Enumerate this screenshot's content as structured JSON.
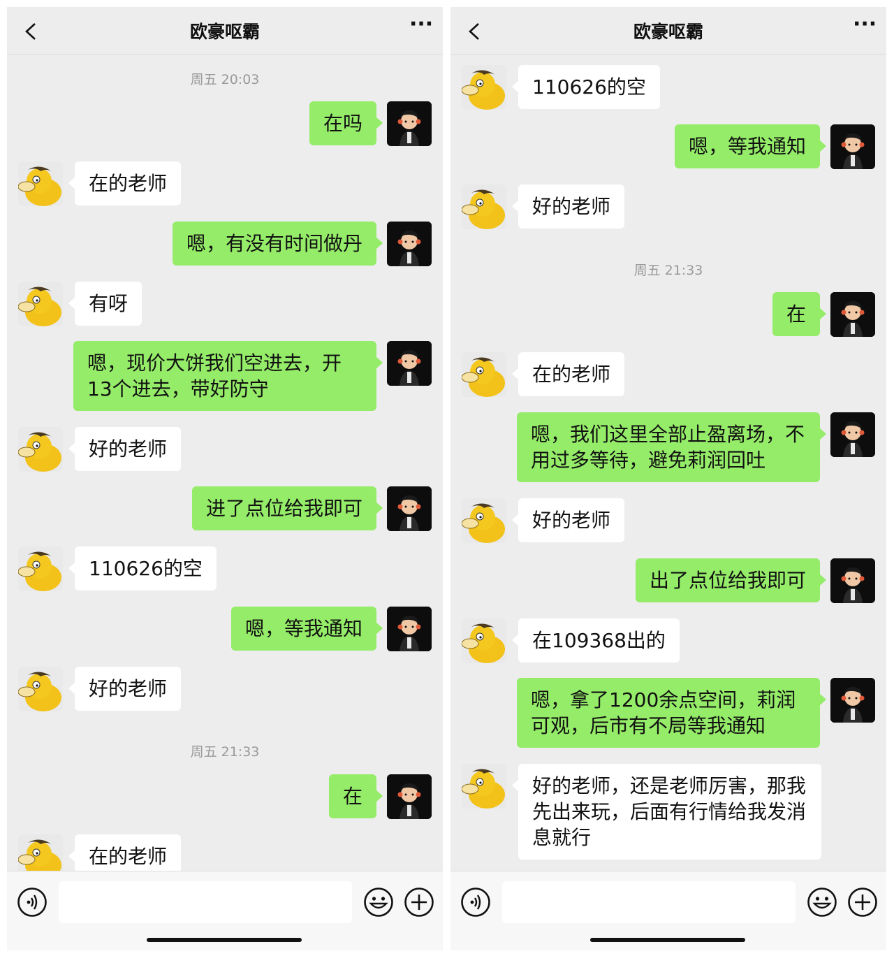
{
  "icons": {
    "back": "chevron-left-icon",
    "more": "ellipsis-icon",
    "voice": "voice-icon",
    "emoji": "smile-icon",
    "plus": "plus-circle-icon"
  },
  "colors": {
    "outgoing_bubble": "#95ec69",
    "incoming_bubble": "#ffffff",
    "chat_background": "#ededed"
  },
  "left": {
    "title": "欧豪呕霸",
    "more_label": "···",
    "messages": [
      {
        "type": "time",
        "text": "周五 20:03"
      },
      {
        "type": "out",
        "text": "在吗"
      },
      {
        "type": "in",
        "text": "在的老师"
      },
      {
        "type": "out",
        "text": "嗯，有没有时间做丹"
      },
      {
        "type": "in",
        "text": "有呀"
      },
      {
        "type": "out",
        "text": "嗯，现价大饼我们空进去，开13个进去，带好防守"
      },
      {
        "type": "in",
        "text": "好的老师"
      },
      {
        "type": "out",
        "text": "进了点位给我即可"
      },
      {
        "type": "in",
        "text": "110626的空"
      },
      {
        "type": "out",
        "text": "嗯，等我通知"
      },
      {
        "type": "in",
        "text": "好的老师"
      },
      {
        "type": "time",
        "text": "周五 21:33"
      },
      {
        "type": "out",
        "text": "在"
      },
      {
        "type": "in",
        "text": "在的老师"
      }
    ]
  },
  "right": {
    "title": "欧豪呕霸",
    "more_label": "···",
    "messages": [
      {
        "type": "in",
        "text": "110626的空"
      },
      {
        "type": "out",
        "text": "嗯，等我通知"
      },
      {
        "type": "in",
        "text": "好的老师"
      },
      {
        "type": "time",
        "text": "周五 21:33"
      },
      {
        "type": "out",
        "text": "在"
      },
      {
        "type": "in",
        "text": "在的老师"
      },
      {
        "type": "out",
        "text": "嗯，我们这里全部止盈离场，不用过多等待，避免莉润回吐"
      },
      {
        "type": "in",
        "text": "好的老师"
      },
      {
        "type": "out",
        "text": "出了点位给我即可"
      },
      {
        "type": "in",
        "text": "在109368出的"
      },
      {
        "type": "out",
        "text": "嗯，拿了1200余点空间，莉润可观，后市有不局等我通知"
      },
      {
        "type": "in",
        "text": "好的老师，还是老师厉害，那我先出来玩，后面有行情给我发消息就行"
      }
    ]
  }
}
